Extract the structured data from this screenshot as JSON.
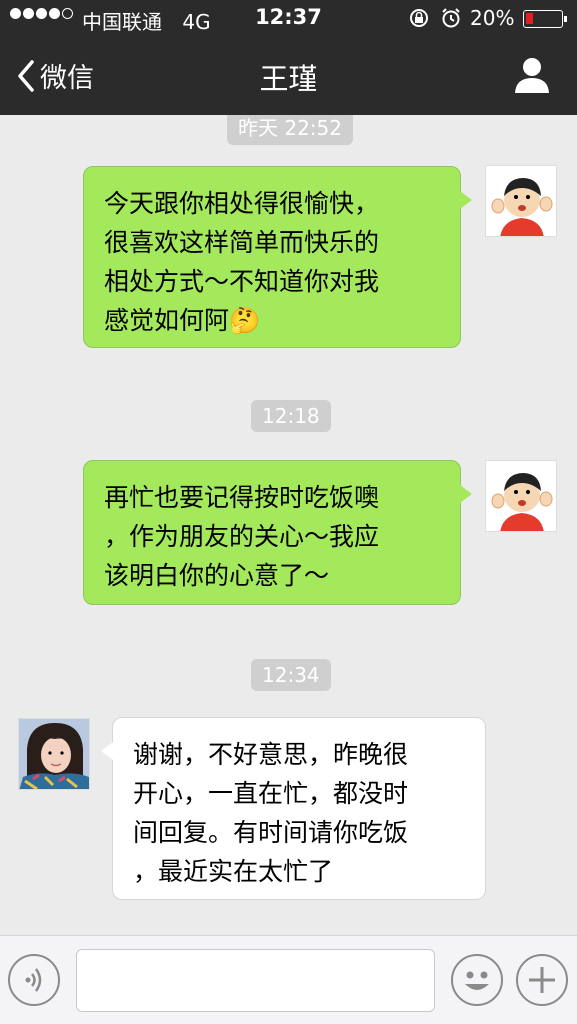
{
  "status_bar": {
    "carrier": "中国联通",
    "network": "4G",
    "time": "12:37",
    "battery_percent": "20%",
    "battery_level": 0.2,
    "battery_color": "#e02020"
  },
  "nav": {
    "back_label": "微信",
    "title": "王瑾",
    "back_icon": "chevron-left-icon",
    "contact_icon": "user-icon"
  },
  "messages": [
    {
      "type": "time",
      "text": "昨天 22:52"
    },
    {
      "type": "outgoing",
      "lines": [
        "今天跟你相处得很愉快，",
        "很喜欢这样简单而快乐的",
        "相处方式～不知道你对我",
        "感觉如何阿"
      ],
      "emoji": "🤔"
    },
    {
      "type": "time",
      "text": "12:18"
    },
    {
      "type": "outgoing",
      "lines": [
        "再忙也要记得按时吃饭噢",
        "，作为朋友的关心～我应",
        "该明白你的心意了～"
      ]
    },
    {
      "type": "time",
      "text": "12:34"
    },
    {
      "type": "incoming",
      "lines": [
        "谢谢，不好意思，昨晚很",
        "开心，一直在忙，都没时",
        "间回复。有时间请你吃饭",
        "，最近实在太忙了"
      ]
    }
  ],
  "input_bar": {
    "voice_icon": "voice-icon",
    "emoji_icon": "smiley-icon",
    "plus_icon": "plus-icon"
  },
  "colors": {
    "nav_bg": "#2b2b2b",
    "chat_bg": "#ebebeb",
    "outgoing_bubble": "#a4e85c",
    "incoming_bubble": "#ffffff"
  }
}
